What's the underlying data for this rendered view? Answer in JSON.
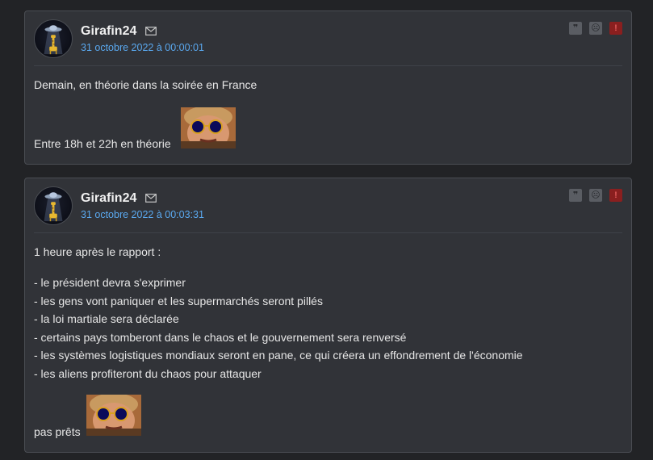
{
  "posts": [
    {
      "author": "Girafin24",
      "date": "31 octobre 2022 à 00:00:01",
      "line1": "Demain, en théorie dans la soirée en France",
      "line2": "Entre 18h et 22h en théorie",
      "actions": {
        "quote": "❞",
        "sad": "☹",
        "report": "!"
      }
    },
    {
      "author": "Girafin24",
      "date": "31 octobre 2022 à 00:03:31",
      "intro": "1 heure après le rapport :",
      "items": [
        "- le président devra s'exprimer",
        "- les gens vont paniquer et les supermarchés seront pillés",
        "- la loi martiale sera déclarée",
        "- certains pays tomberont dans le chaos et le gouvernement sera renversé",
        "- les systèmes logistiques mondiaux seront en pane, ce qui créera un effondrement de l'économie",
        "- les aliens profiteront du chaos pour attaquer"
      ],
      "outro": "pas prêts",
      "actions": {
        "quote": "❞",
        "sad": "☹",
        "report": "!"
      }
    }
  ],
  "icons": {
    "avatar": "ufo-giraffe-avatar",
    "mail": "mail-icon",
    "sticker": "sunglasses-man-sticker"
  },
  "colors": {
    "background": "#222326",
    "card": "#313338",
    "date": "#5aa9f0",
    "report": "#8a1f1f"
  }
}
